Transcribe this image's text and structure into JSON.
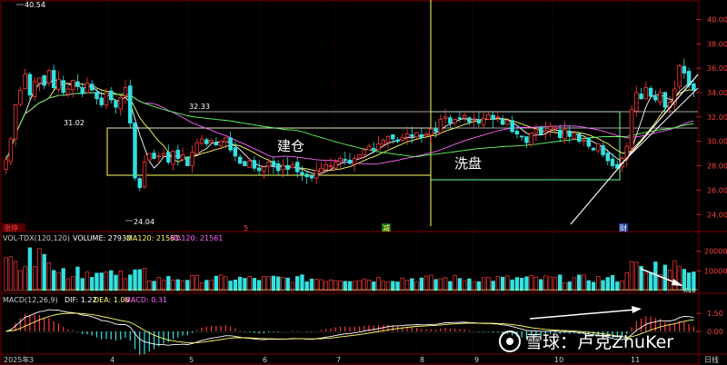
{
  "chart_data": {
    "type": "candlestick",
    "price_axis": {
      "ticks": [
        "40.00",
        "38.00",
        "36.00",
        "34.00",
        "32.00",
        "30.00",
        "28.00",
        "26.00",
        "24.00"
      ],
      "range": [
        23.2,
        41.0
      ]
    },
    "volume_axis": {
      "ticks": [
        "20000",
        "10000",
        "X10"
      ],
      "range": [
        0,
        24000
      ]
    },
    "macd_axis": {
      "ticks": [
        "1.50",
        "0.00"
      ],
      "range": [
        -1.6,
        2.2
      ]
    },
    "x_axis": {
      "labels": [
        "2025年",
        "3",
        "4",
        "5",
        "6",
        "7",
        "8",
        "9",
        "10",
        "11"
      ],
      "right_label": "日线"
    },
    "annotations": {
      "high": "40.54",
      "low": "24.04",
      "level_1": "31.02",
      "level_2": "32.33",
      "zone_build": "建仓",
      "zone_wash": "洗盘",
      "marker_left": "涨停",
      "marker_a": "5",
      "marker_b": "减",
      "marker_c": "财"
    },
    "volume_header": {
      "label": "VOL-TDX(120,120)",
      "volume": "VOLUME: 27930",
      "ma1": "MA120: 21561",
      "ma2": "MA120: 21561"
    },
    "macd_header": {
      "label": "MACD(12,26,9)",
      "dif": "DIF: 1.22",
      "dea": "DEA: 1.06",
      "macd": "MACD: 0.31"
    },
    "watermark": "雪球：卢克ZhuKer",
    "closes": [
      28.5,
      30.2,
      33.0,
      34.2,
      35.5,
      33.8,
      34.9,
      35.2,
      34.6,
      35.8,
      34.4,
      35.1,
      34.0,
      34.3,
      35.0,
      34.5,
      33.9,
      34.8,
      34.2,
      33.5,
      33.0,
      34.0,
      33.4,
      32.8,
      33.6,
      34.4,
      31.5,
      27.0,
      26.2,
      28.3,
      29.0,
      28.6,
      28.8,
      29.0,
      28.3,
      29.2,
      28.6,
      28.9,
      28.0,
      29.1,
      29.9,
      30.2,
      29.8,
      30.1,
      29.7,
      30.0,
      30.3,
      29.3,
      28.8,
      28.2,
      28.0,
      28.4,
      27.8,
      27.6,
      27.9,
      28.3,
      28.0,
      27.6,
      28.0,
      27.7,
      28.1,
      27.5,
      27.3,
      27.1,
      27.0,
      27.6,
      27.8,
      28.1,
      28.0,
      28.3,
      28.6,
      28.5,
      28.2,
      28.6,
      28.9,
      29.3,
      29.6,
      29.3,
      29.8,
      30.1,
      30.4,
      30.2,
      30.0,
      30.3,
      30.6,
      30.4,
      30.7,
      30.3,
      30.6,
      31.0,
      30.8,
      31.8,
      32.0,
      31.5,
      31.8,
      31.9,
      32.1,
      31.6,
      31.8,
      31.5,
      31.9,
      32.2,
      31.8,
      32.0,
      31.4,
      31.7,
      30.8,
      30.6,
      30.4,
      29.9,
      30.7,
      31.0,
      30.6,
      30.9,
      31.2,
      31.1,
      30.3,
      31.0,
      30.4,
      30.7,
      30.0,
      30.1,
      29.6,
      29.3,
      29.8,
      28.9,
      28.4,
      28.0,
      27.8,
      28.6,
      29.6,
      32.6,
      34.0,
      33.5,
      34.4,
      33.7,
      33.4,
      34.0,
      32.8,
      33.2,
      34.3,
      36.2,
      35.6,
      34.6,
      34.2
    ]
  }
}
